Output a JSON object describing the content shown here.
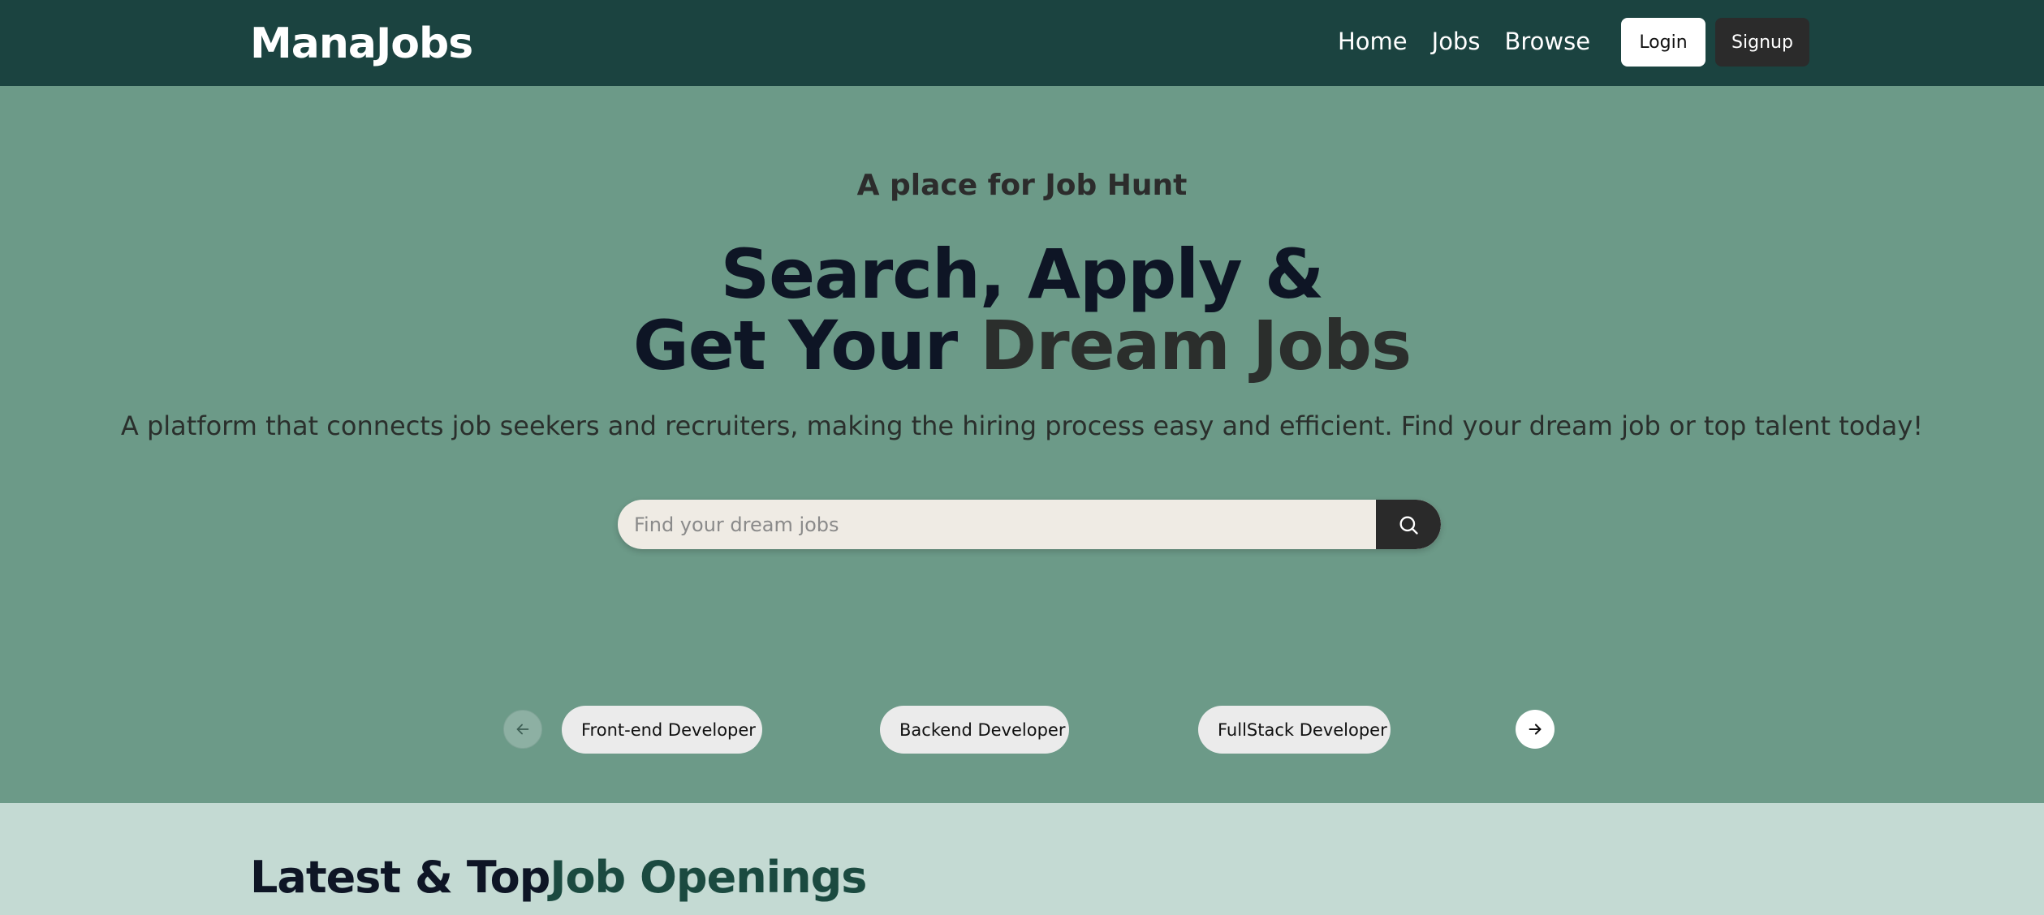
{
  "navbar": {
    "logo": "ManaJobs",
    "links": [
      "Home",
      "Jobs",
      "Browse"
    ],
    "login_label": "Login",
    "signup_label": "Signup"
  },
  "hero": {
    "tagline": "A place for Job Hunt",
    "headline_line1": "Search, Apply &",
    "headline_line2_prefix": "Get Your ",
    "headline_line2_accent": "Dream Jobs",
    "subtitle": "A platform that connects job seekers and recruiters, making the hiring process easy and efficient. Find your dream job or top talent today!"
  },
  "search": {
    "placeholder": "Find your dream jobs",
    "value": "",
    "icon": "search-icon"
  },
  "carousel": {
    "prev_icon": "arrow-left-icon",
    "next_icon": "arrow-right-icon",
    "categories": [
      "Front-end Developer",
      "Backend Developer",
      "FullStack Developer"
    ]
  },
  "latest": {
    "title_prefix": "Latest & Top",
    "title_accent": "Job Openings"
  },
  "colors": {
    "navbar": "#1b4340",
    "hero_bg": "#6c9a88",
    "section_bg": "#c4dad3",
    "accent_dark": "#1b4a40"
  }
}
